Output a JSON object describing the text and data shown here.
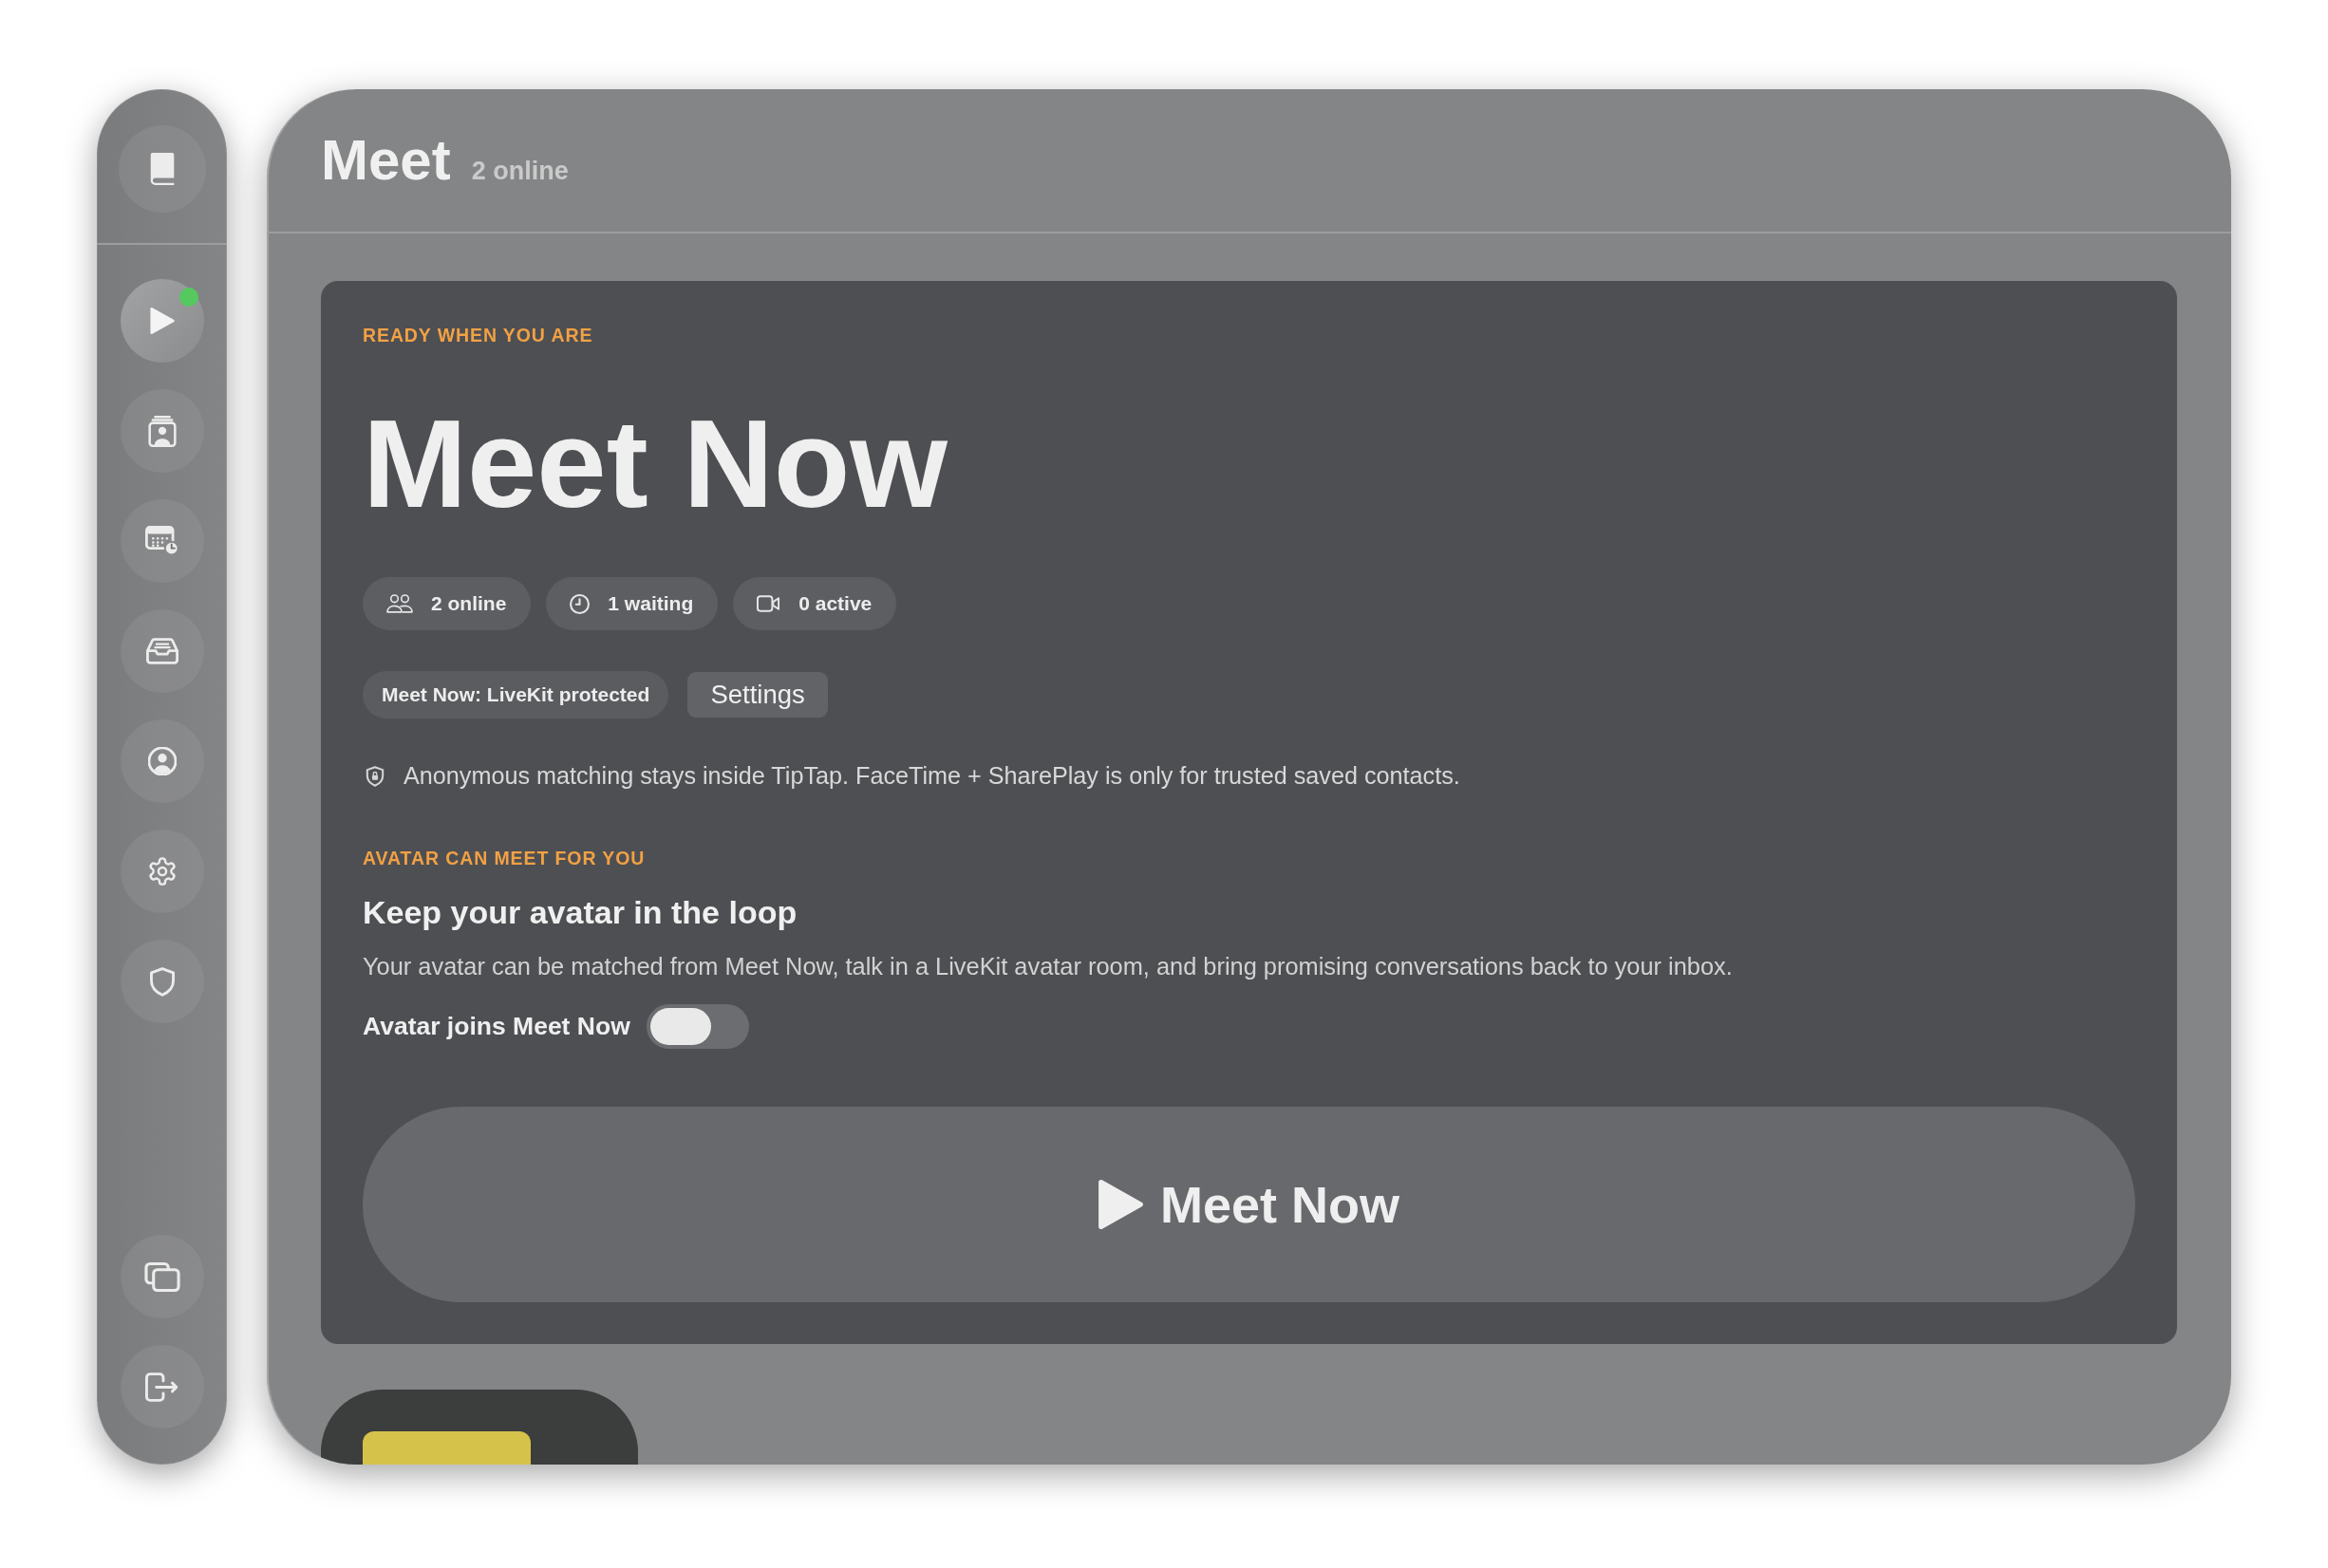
{
  "sidebar": {
    "top_items": [
      {
        "selected": false
      }
    ],
    "items": [
      {
        "selected": true,
        "status_dot": true
      },
      {
        "selected": false,
        "status_dot": false
      },
      {
        "selected": false,
        "status_dot": false
      },
      {
        "selected": false,
        "status_dot": false
      },
      {
        "selected": false,
        "status_dot": false
      },
      {
        "selected": false,
        "status_dot": false
      },
      {
        "selected": false,
        "status_dot": false
      }
    ],
    "bottom_items": [
      {
        "selected": false
      },
      {
        "selected": false
      }
    ]
  },
  "header": {
    "title": "Meet",
    "subtitle": "2 online"
  },
  "hero": {
    "eyebrow": "READY WHEN YOU ARE",
    "title": "Meet Now",
    "stats": [
      {
        "label": "2 online"
      },
      {
        "label": "1 waiting"
      },
      {
        "label": "0 active"
      }
    ],
    "badge": "Meet Now: LiveKit protected",
    "settings_button": "Settings",
    "notice": "Anonymous matching stays inside TipTap. FaceTime + SharePlay is only for trusted saved contacts."
  },
  "avatar_section": {
    "eyebrow": "AVATAR CAN MEET FOR YOU",
    "heading": "Keep your avatar in the loop",
    "description": "Your avatar can be matched from Meet Now, talk in a LiveKit avatar room, and bring promising conversations back to your inbox.",
    "toggle": {
      "label": "Avatar joins Meet Now",
      "on": false
    }
  },
  "primary_button": {
    "label": "Meet Now"
  }
}
